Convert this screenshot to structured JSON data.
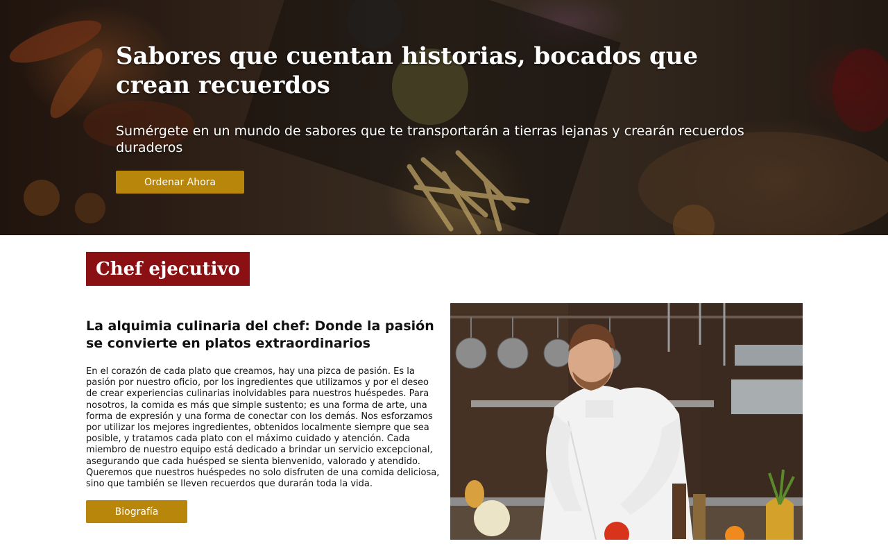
{
  "hero": {
    "title": "Sabores que cuentan historias, bocados que crean recuerdos",
    "subtitle": "Sumérgete en un mundo de sabores que te transportarán a tierras lejanas y crearán recuerdos duraderos",
    "cta_label": "Ordenar Ahora"
  },
  "section": {
    "badge": "Chef ejecutivo"
  },
  "about": {
    "heading": "La alquimia culinaria del chef: Donde la pasión se convierte en platos extraordinarios",
    "body": "En el corazón de cada plato que creamos, hay una pizca de pasión. Es la pasión por nuestro oficio, por los ingredientes que utilizamos y por el deseo de crear experiencias culinarias inolvidables para nuestros huéspedes. Para nosotros, la comida es más que simple sustento; es una forma de arte, una forma de expresión y una forma de conectar con los demás. Nos esforzamos por utilizar los mejores ingredientes, obtenidos localmente siempre que sea posible, y tratamos cada plato con el máximo cuidado y atención. Cada miembro de nuestro equipo está dedicado a brindar un servicio excepcional, asegurando que cada huésped se sienta bienvenido, valorado y atendido. Queremos que nuestros huéspedes no solo disfruten de una comida deliciosa, sino que también se lleven recuerdos que durarán toda la vida.",
    "button_label": "Biografía"
  },
  "colors": {
    "accent_gold": "#b8860b",
    "badge_red": "#8b1014"
  }
}
